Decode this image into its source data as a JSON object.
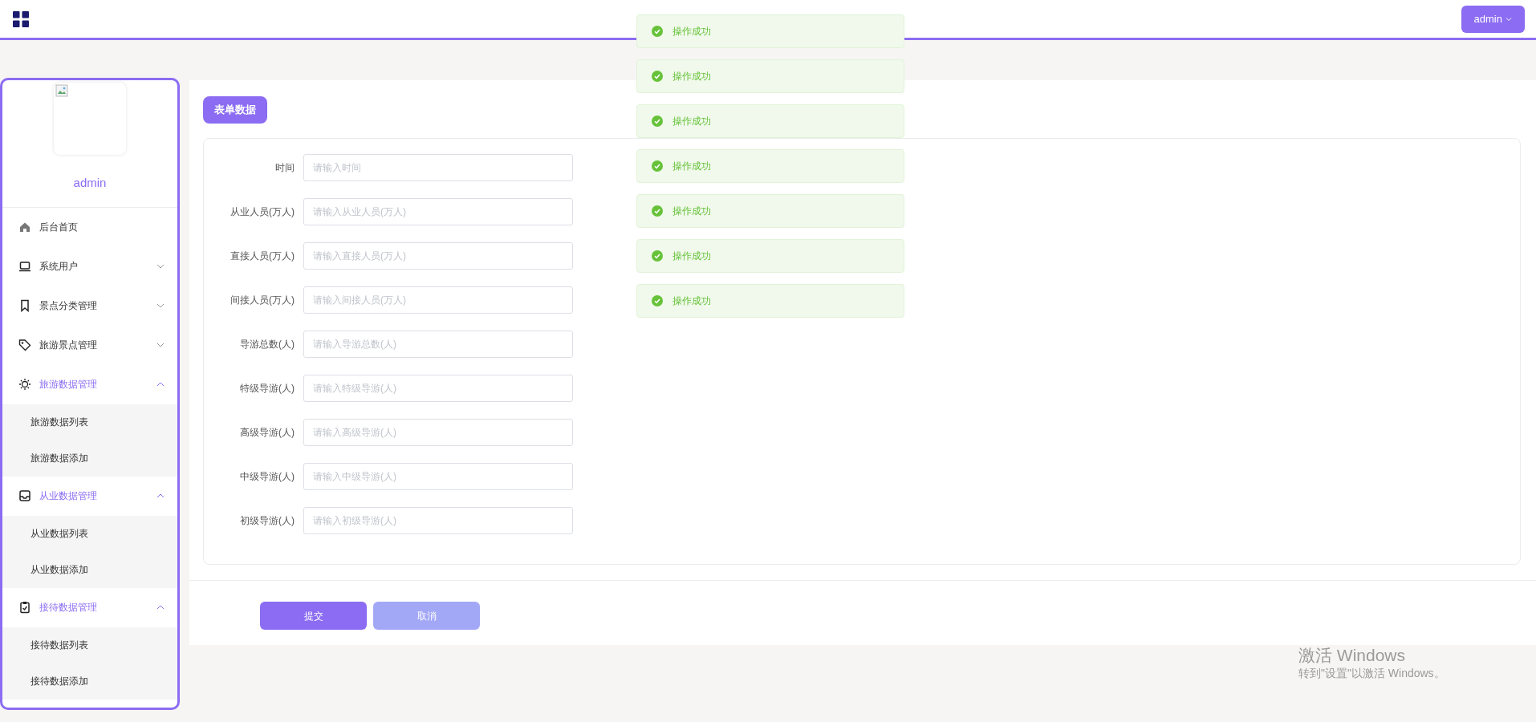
{
  "topbar": {
    "user_button": "admin"
  },
  "sidebar": {
    "username": "admin",
    "items": [
      {
        "label": "后台首页"
      },
      {
        "label": "系统用户",
        "expanded": false
      },
      {
        "label": "景点分类管理",
        "expanded": false
      },
      {
        "label": "旅游景点管理",
        "expanded": false
      },
      {
        "label": "旅游数据管理",
        "expanded": true,
        "children": [
          {
            "label": "旅游数据列表"
          },
          {
            "label": "旅游数据添加"
          }
        ]
      },
      {
        "label": "从业数据管理",
        "expanded": true,
        "children": [
          {
            "label": "从业数据列表"
          },
          {
            "label": "从业数据添加"
          }
        ]
      },
      {
        "label": "接待数据管理",
        "expanded": true,
        "children": [
          {
            "label": "接待数据列表"
          },
          {
            "label": "接待数据添加"
          }
        ]
      }
    ]
  },
  "form": {
    "tab": "表单数据",
    "fields": [
      {
        "label": "时间",
        "placeholder": "请输入时间"
      },
      {
        "label": "从业人员(万人)",
        "placeholder": "请输入从业人员(万人)"
      },
      {
        "label": "直接人员(万人)",
        "placeholder": "请输入直接人员(万人)"
      },
      {
        "label": "间接人员(万人)",
        "placeholder": "请输入间接人员(万人)"
      },
      {
        "label": "导游总数(人)",
        "placeholder": "请输入导游总数(人)"
      },
      {
        "label": "特级导游(人)",
        "placeholder": "请输入特级导游(人)"
      },
      {
        "label": "高级导游(人)",
        "placeholder": "请输入高级导游(人)"
      },
      {
        "label": "中级导游(人)",
        "placeholder": "请输入中级导游(人)"
      },
      {
        "label": "初级导游(人)",
        "placeholder": "请输入初级导游(人)"
      }
    ],
    "buttons": [
      {
        "label": "提交",
        "kind": "primary"
      },
      {
        "label": "取消",
        "kind": "secondary"
      }
    ]
  },
  "toasts": [
    {
      "text": "操作成功",
      "kind": "success"
    },
    {
      "text": "操作成功",
      "kind": "success"
    },
    {
      "text": "操作成功",
      "kind": "success"
    },
    {
      "text": "操作成功",
      "kind": "success"
    },
    {
      "text": "操作成功",
      "kind": "success"
    },
    {
      "text": "操作成功",
      "kind": "success"
    },
    {
      "text": "操作成功",
      "kind": "success"
    }
  ],
  "os_notice": {
    "title": "激活 Windows",
    "subtitle": "转到\"设置\"以激活 Windows。"
  }
}
